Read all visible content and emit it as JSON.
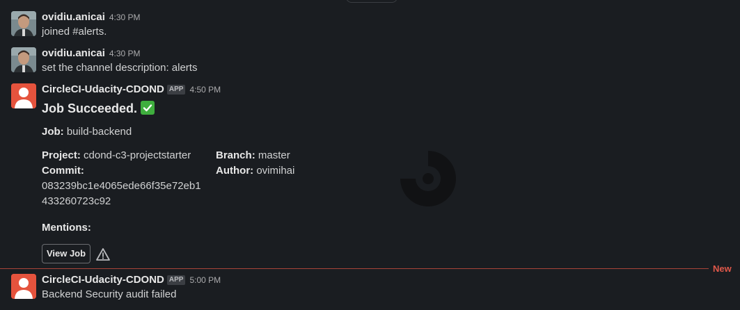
{
  "messages": [
    {
      "author": "ovidiu.anicai",
      "time": "4:30 PM",
      "text": "joined #alerts."
    },
    {
      "author": "ovidiu.anicai",
      "time": "4:30 PM",
      "text": "set the channel description: alerts"
    },
    {
      "author": "CircleCI-Udacity-CDOND",
      "badge": "APP",
      "time": "4:50 PM",
      "title": "Job Succeeded.",
      "job_label": "Job",
      "job_value": "build-backend",
      "project_label": "Project",
      "project_value": "cdond-c3-projectstarter",
      "branch_label": "Branch",
      "branch_value": "master",
      "commit_label": "Commit",
      "commit_value_line1": "083239bc1e4065ede66f35e72eb1",
      "commit_value_line2": "433260723c92",
      "author_label": "Author",
      "author_value": "ovimihai",
      "mentions_label": "Mentions:",
      "button_label": "View Job"
    },
    {
      "author": "CircleCI-Udacity-CDOND",
      "badge": "APP",
      "time": "5:00 PM",
      "text": "Backend Security audit failed"
    }
  ],
  "divider_label": "New",
  "colors": {
    "background": "#1a1d21",
    "circleci_avatar": "#e5533d",
    "new_divider": "#a94539",
    "check": "#3fae3e"
  },
  "icons": [
    "check-mark-icon",
    "warning-icon",
    "circleci-logo-icon"
  ]
}
